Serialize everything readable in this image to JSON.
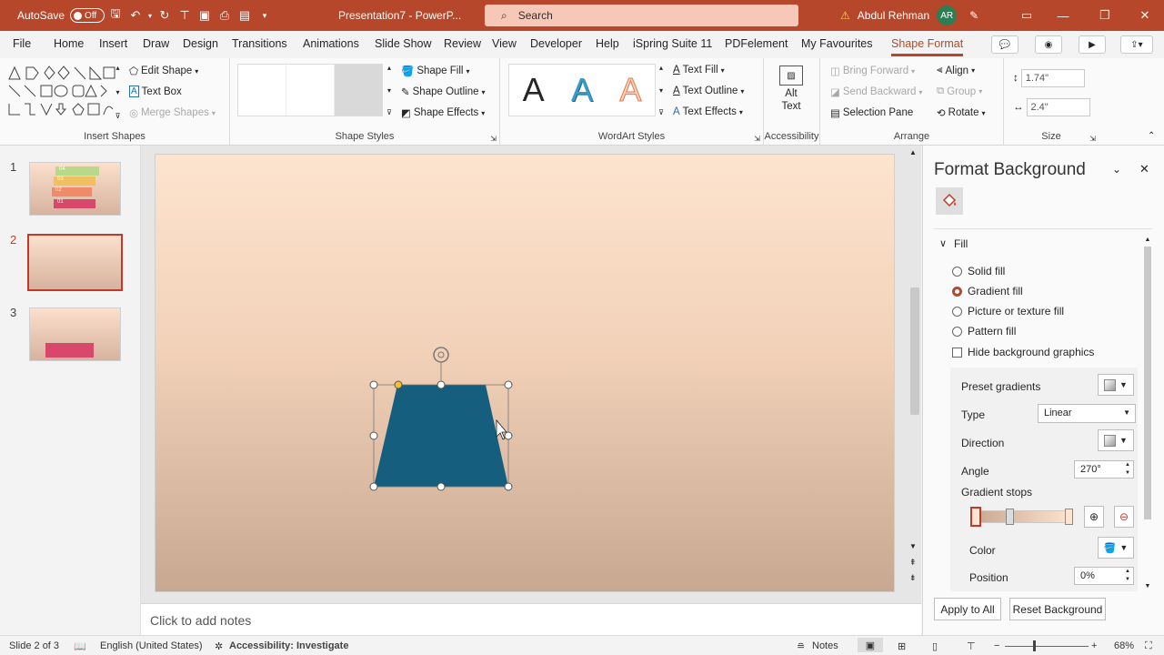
{
  "titlebar": {
    "autosave_label": "AutoSave",
    "autosave_state": "Off",
    "file_title": "Presentation7 - PowerP...",
    "search_placeholder": "Search",
    "user_name": "Abdul Rehman",
    "user_initials": "AR"
  },
  "tabs": [
    "File",
    "Home",
    "Insert",
    "Draw",
    "Design",
    "Transitions",
    "Animations",
    "Slide Show",
    "Review",
    "View",
    "Developer",
    "Help",
    "iSpring Suite 11",
    "PDFelement",
    "My Favourites",
    "Shape Format"
  ],
  "ribbon": {
    "insert_shapes": {
      "label": "Insert Shapes",
      "edit_shape": "Edit Shape",
      "text_box": "Text Box",
      "merge_shapes": "Merge Shapes"
    },
    "shape_styles": {
      "label": "Shape Styles",
      "shape_fill": "Shape Fill",
      "shape_outline": "Shape Outline",
      "shape_effects": "Shape Effects"
    },
    "wordart_styles": {
      "label": "WordArt Styles",
      "sample": "A",
      "text_fill": "Text Fill",
      "text_outline": "Text Outline",
      "text_effects": "Text Effects"
    },
    "accessibility": {
      "label": "Accessibility",
      "alt_text": "Alt Text"
    },
    "arrange": {
      "label": "Arrange",
      "bring_forward": "Bring Forward",
      "send_backward": "Send Backward",
      "selection_pane": "Selection Pane",
      "align": "Align",
      "group": "Group",
      "rotate": "Rotate"
    },
    "size": {
      "label": "Size",
      "height": "1.74\"",
      "width": "2.4\""
    }
  },
  "thumbnails": [
    {
      "num": "1",
      "labels": [
        "04",
        "03",
        "02",
        "01"
      ]
    },
    {
      "num": "2"
    },
    {
      "num": "3"
    }
  ],
  "notes_placeholder": "Click to add notes",
  "colors": {
    "accent": "#b7472a",
    "shape_fill": "#155e7d",
    "handle_yellow": "#f2c12e"
  },
  "format_pane": {
    "title": "Format Background",
    "fill_section": "Fill",
    "options": [
      "Solid fill",
      "Gradient fill",
      "Picture or texture fill",
      "Pattern fill"
    ],
    "selected_option": "Gradient fill",
    "hide_background": "Hide background graphics",
    "preset_gradients": "Preset gradients",
    "type_label": "Type",
    "type_value": "Linear",
    "direction_label": "Direction",
    "angle_label": "Angle",
    "angle_value": "270°",
    "gradient_stops": "Gradient stops",
    "color_label": "Color",
    "position_label": "Position",
    "position_value": "0%",
    "apply_all": "Apply to All",
    "reset_background": "Reset Background"
  },
  "status": {
    "slide_info": "Slide 2 of 3",
    "language": "English (United States)",
    "accessibility": "Accessibility: Investigate",
    "notes": "Notes",
    "zoom": "68%"
  }
}
